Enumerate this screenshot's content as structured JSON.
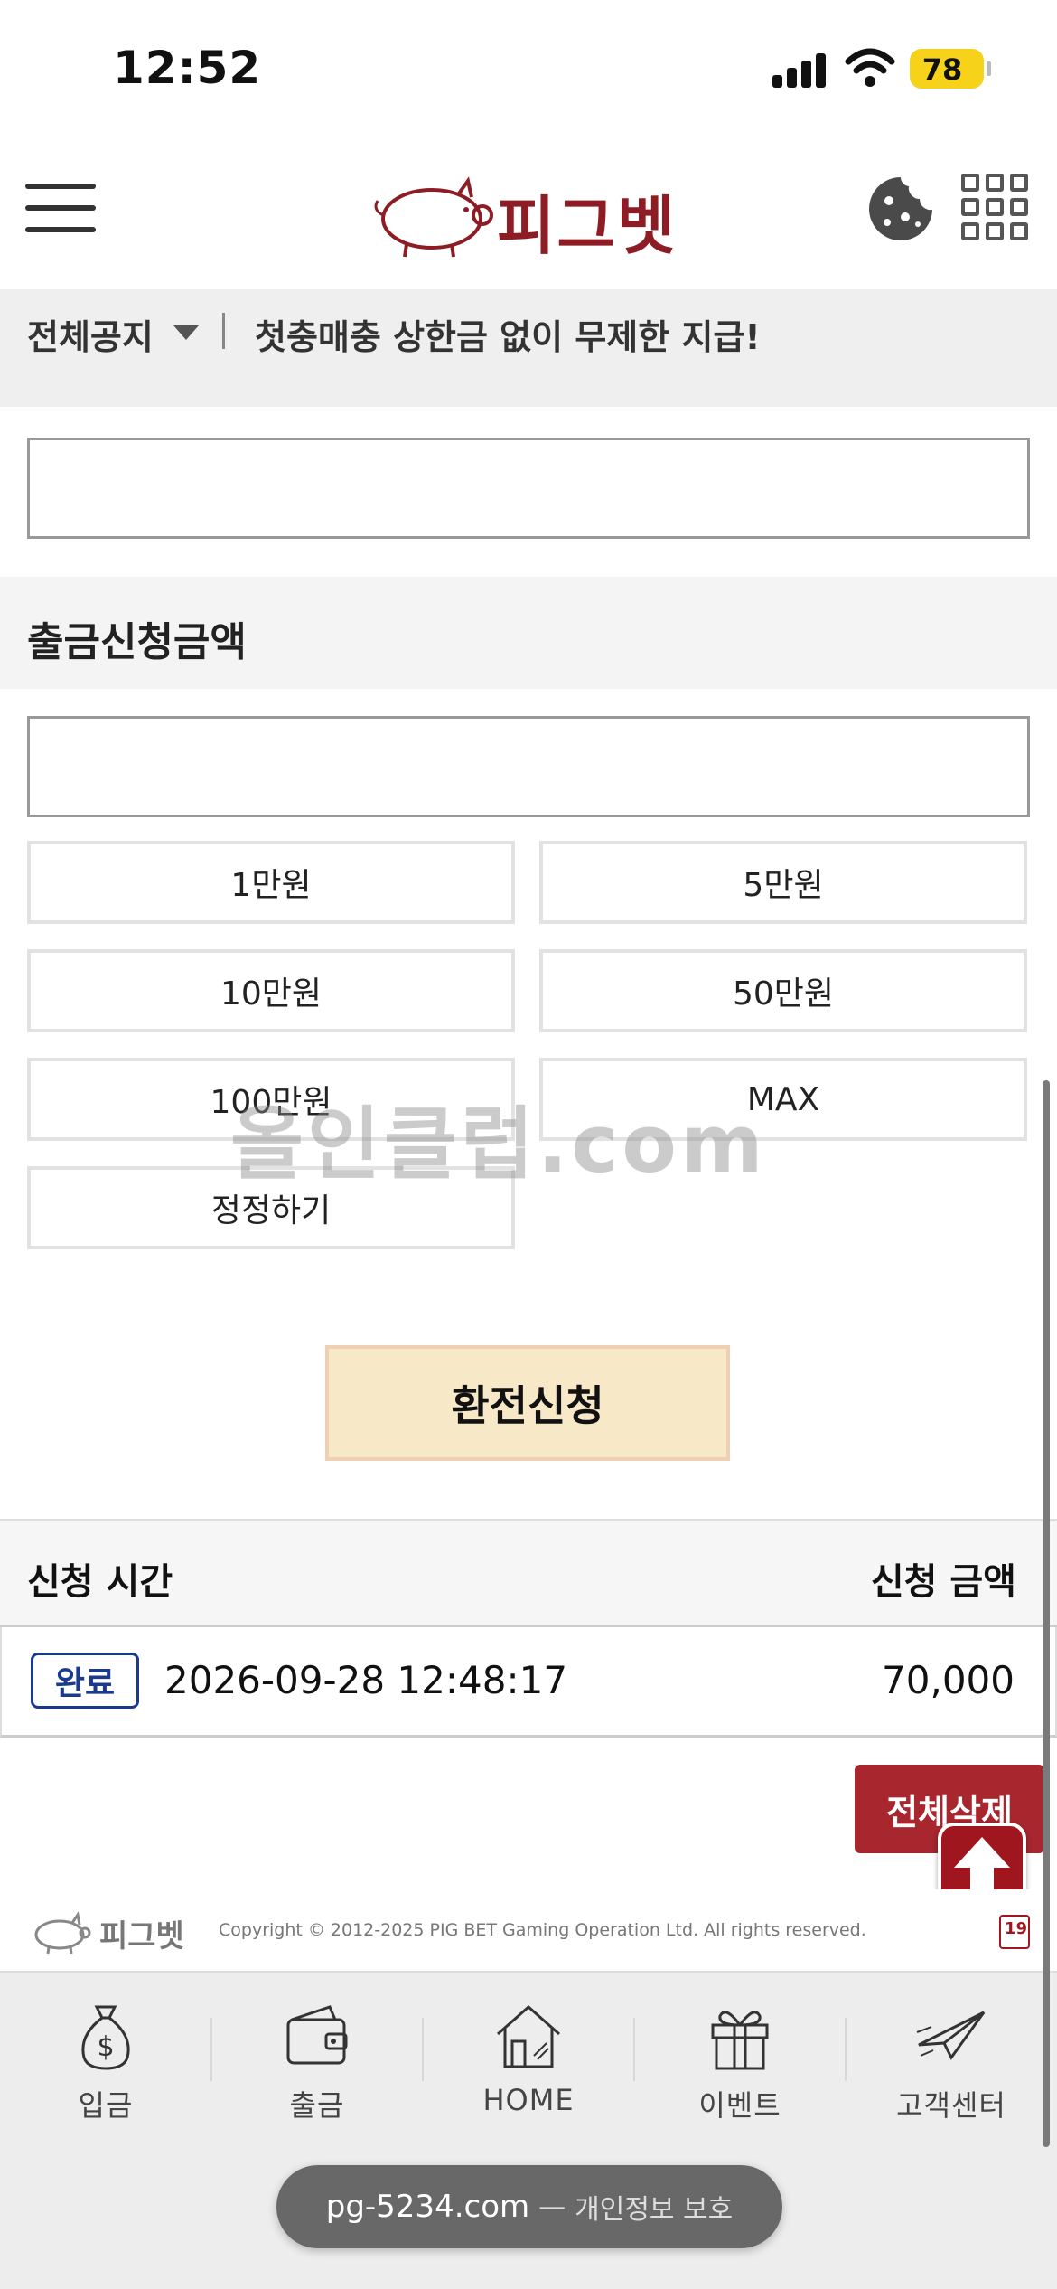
{
  "status_bar": {
    "time": "12:52",
    "battery": "78"
  },
  "header": {
    "brand": "피그벳"
  },
  "notice": {
    "label": "전체공지",
    "text": "첫충매충 상한금 없이 무제한 지급!"
  },
  "form": {
    "amount_section_title": "출금신청금액",
    "quick_amounts": [
      "1만원",
      "5만원",
      "10만원",
      "50만원",
      "100만원",
      "MAX"
    ],
    "reset_label": "정정하기",
    "submit_label": "환전신청"
  },
  "watermark": "올인클럽.com",
  "history": {
    "col_time": "신청 시간",
    "col_amount": "신청 금액",
    "rows": [
      {
        "status": "완료",
        "time": "2026-09-28 12:48:17",
        "amount": "70,000"
      }
    ],
    "delete_all_label": "전체삭제"
  },
  "footer": {
    "brand": "피그벳",
    "copyright": "Copyright © 2012-2025 PIG BET Gaming Operation Ltd. All rights reserved.",
    "age_badge": "19"
  },
  "bottom_nav": [
    {
      "label": "입금",
      "icon": "money-bag-icon"
    },
    {
      "label": "출금",
      "icon": "wallet-icon"
    },
    {
      "label": "HOME",
      "icon": "house-icon"
    },
    {
      "label": "이벤트",
      "icon": "gift-icon"
    },
    {
      "label": "고객센터",
      "icon": "paper-plane-icon"
    }
  ],
  "browser": {
    "domain": "pg-5234.com",
    "separator": "—",
    "note": "개인정보 보호"
  },
  "colors": {
    "brand_red": "#a8262e",
    "submit_bg": "#f7e8c8",
    "badge_blue": "#1a3a8f",
    "battery": "#f6d21a"
  }
}
